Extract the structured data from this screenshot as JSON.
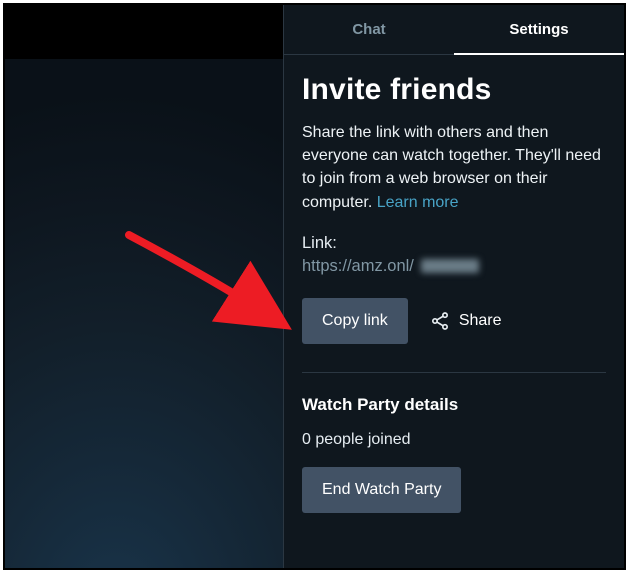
{
  "tabs": {
    "chat": "Chat",
    "settings": "Settings"
  },
  "heading": "Invite friends",
  "description_pre": "Share the link with others and then everyone can watch together. They'll need to join from a web browser on their computer. ",
  "learn_more": "Learn more",
  "link_label": "Link:",
  "link_url": "https://amz.onl/",
  "copy_button": "Copy link",
  "share_label": "Share",
  "details_heading": "Watch Party details",
  "joined_count": 0,
  "joined_text": "0 people joined",
  "end_button": "End Watch Party"
}
